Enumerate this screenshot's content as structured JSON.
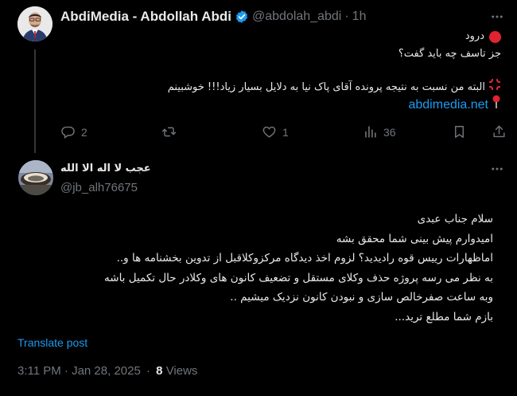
{
  "tweet": {
    "author_name": "AbdiMedia - Abdollah Abdi",
    "handle": "@abdolah_abdi",
    "separator": "·",
    "time": "1h",
    "lines": [
      "درود",
      "جز تاسف چه باید گفت؟",
      "البته من نسبت به نتیجه پرونده آقای پاک نیا به دلایل بسیار زیاد!!! خوشبینم"
    ],
    "link": "abdimedia.net",
    "replies": "2",
    "likes": "1",
    "views": "36",
    "accent_color": "#1d9bf0",
    "red_circle_color": "#e0242f"
  },
  "reply": {
    "author_name": "عجب لا اله الا الله",
    "handle": "@jb_alh76675",
    "lines": [
      "سلام جناب عبدی",
      "امیدوارم پیش بینی شما محقق بشه",
      "اماظهارات رییس قوه رادیدید؟ لزوم اخذ دیدگاه مرکزوکلاقبل از تدوین بخشنامه ها و..",
      "به نظر می رسه پروژه حذف وکلای مستقل و تضعیف کانون های وکلادر حال تکمیل باشه",
      "وبه ساعت صفرخالص سازی و نبودن کانون نزدیک میشیم ..",
      "بازم شما مطلع ترید..."
    ],
    "translate_label": "Translate post",
    "timestamp": "3:11 PM · Jan 28, 2025",
    "meta_separator": "·",
    "views_count": "8",
    "views_label": "Views"
  }
}
